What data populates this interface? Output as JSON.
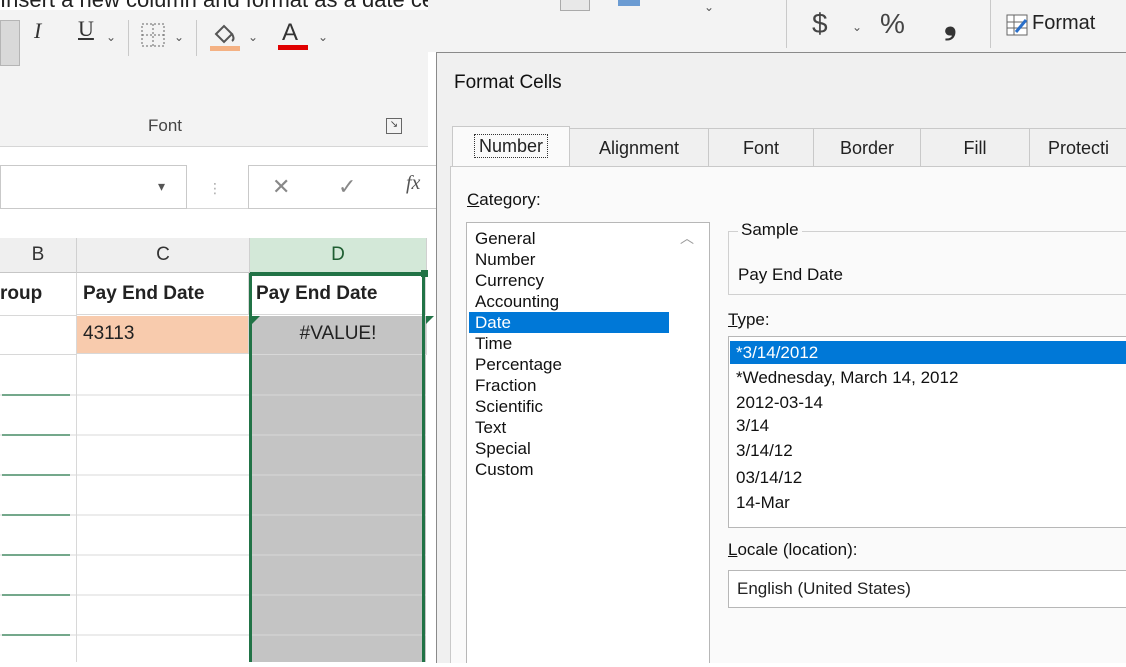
{
  "caption": "Insert a new column and format as a date cell",
  "ribbon": {
    "italic": "I",
    "underline": "U",
    "font_group_label": "Font",
    "currency": "$",
    "percent": "%",
    "comma": "❟",
    "format_label": "Format",
    "fill_color": "#f4b183",
    "font_color": "#e00000"
  },
  "formula_bar": {
    "cancel": "✕",
    "enter": "✓",
    "fx": "fx"
  },
  "grid": {
    "columns": [
      "B",
      "C",
      "D"
    ],
    "header_row": [
      "roup",
      "Pay End Date",
      "Pay End Date"
    ],
    "row1": [
      "",
      "43113",
      "#VALUE!"
    ],
    "highlight_color": "#f8cbad",
    "selected_column": "D"
  },
  "dialog": {
    "title": "Format Cells",
    "tabs": [
      "Number",
      "Alignment",
      "Font",
      "Border",
      "Fill",
      "Protecti"
    ],
    "active_tab": "Number",
    "category_label_u": "C",
    "category_label_rest": "ategory:",
    "categories": [
      "General",
      "Number",
      "Currency",
      "Accounting",
      "Date",
      "Time",
      "Percentage",
      "Fraction",
      "Scientific",
      "Text",
      "Special",
      "Custom"
    ],
    "selected_category": "Date",
    "sample_label": "Sample",
    "sample_value": "Pay End Date",
    "type_label_u": "T",
    "type_label_rest": "ype:",
    "types": [
      "*3/14/2012",
      "*Wednesday, March 14, 2012",
      "2012-03-14",
      "3/14",
      "3/14/12",
      "03/14/12",
      "14-Mar"
    ],
    "selected_type": "*3/14/2012",
    "locale_label_u": "L",
    "locale_label_rest": "ocale (location):",
    "locale_value": "English (United States)"
  }
}
